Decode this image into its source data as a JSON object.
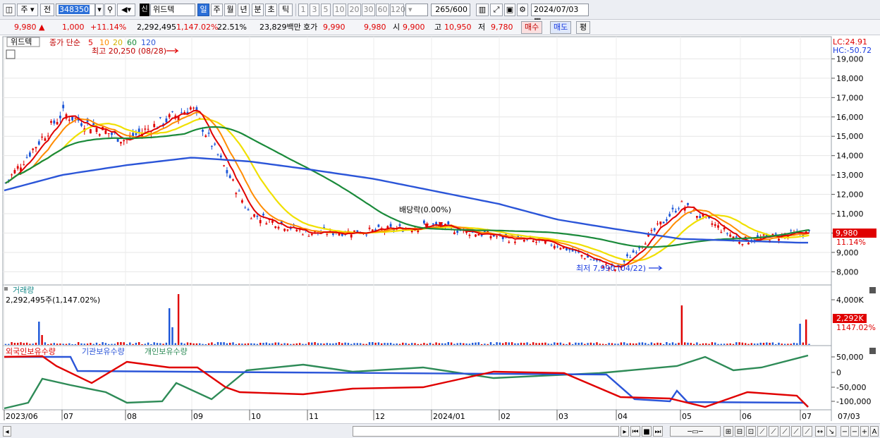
{
  "toolbar": {
    "market_label": "주",
    "prev_label": "전",
    "code": "348350",
    "badge": "신",
    "stock_name": "위드텍",
    "periods": [
      "일",
      "주",
      "월",
      "년",
      "분",
      "초",
      "틱"
    ],
    "active_period": "일",
    "intervals": [
      "1",
      "3",
      "5",
      "10",
      "20",
      "30",
      "60",
      "120"
    ],
    "count_value": "265",
    "count_total": "/600",
    "date": "2024/07/03"
  },
  "quote": {
    "price": "9,980",
    "arrow": "▲",
    "change": "1,000",
    "change_pct": "+11.14%",
    "volume": "2,292,495",
    "volume_pct": "1,147.02%",
    "turnover_pct": "22.51%",
    "amount": "23,829백만",
    "hoga_label": "호가",
    "ask": "9,990",
    "bid": "9,980",
    "open_label": "시",
    "open": "9,900",
    "high_label": "고",
    "high": "10,950",
    "low_label": "저",
    "low": "9,780",
    "buy_label": "매수",
    "sell_label": "매도",
    "avg_label": "평"
  },
  "price_panel": {
    "name_tag": "위드텍",
    "legend_prefix": "종가 단순",
    "ma_labels": [
      "5",
      "10",
      "20",
      "60",
      "120"
    ],
    "ma_colors": [
      "#e00000",
      "#ff8c00",
      "#d4b000",
      "#1a8a3a",
      "#2b55d8"
    ],
    "lc": "LC:24.91",
    "hc": "HC:-50.72",
    "y_ticks": [
      "19,000",
      "18,000",
      "17,000",
      "16,000",
      "15,000",
      "14,000",
      "13,000",
      "12,000",
      "11,000",
      "10,000",
      "9,000",
      "8,000"
    ],
    "current_price_tag": "9,980",
    "current_pct_tag": "11.14%",
    "high_annotation": "최고 20,250 (08/28)",
    "low_annotation": "최저 7,990 (04/22)",
    "dividend_annotation": "배당락(0.00%)"
  },
  "volume_panel": {
    "title": "거래량",
    "value": "2,292,495주(1,147.02%)",
    "y_tick": "4,000K",
    "tag1": "2,292K",
    "tag2": "1147.02%"
  },
  "holding_panel": {
    "series": [
      "외국인보유수량",
      "기관보유수량",
      "개인보유수량"
    ],
    "colors": [
      "#e00000",
      "#2b55d8",
      "#2e8b57"
    ],
    "y_ticks": [
      "50,000",
      "0",
      "-50,000",
      "-100,000"
    ]
  },
  "x_axis": [
    "2023/06",
    "07",
    "08",
    "09",
    "10",
    "11",
    "12",
    "2024/01",
    "02",
    "03",
    "04",
    "05",
    "06",
    "07",
    "07/03"
  ],
  "chart_data": {
    "type": "line",
    "title": "위드텍 (348350) 일봉",
    "x": [
      "2023/06",
      "07",
      "08",
      "09",
      "10",
      "11",
      "12",
      "2024/01",
      "02",
      "03",
      "04",
      "05",
      "06",
      "07"
    ],
    "series": [
      {
        "name": "종가",
        "values": [
          12500,
          16200,
          14800,
          16500,
          11000,
          10000,
          10100,
          10400,
          9800,
          9400,
          8100,
          11500,
          9600,
          9980
        ]
      },
      {
        "name": "120",
        "values": [
          12200,
          13000,
          13500,
          13900,
          13700,
          13300,
          12800,
          12200,
          11500,
          10700,
          10200,
          9700,
          9600,
          9500
        ]
      }
    ],
    "ylim": [
      7500,
      19600
    ],
    "annotations": [
      "최고 20,250 (08/28)",
      "최저 7,990 (04/22)",
      "배당락(0.00%)"
    ]
  }
}
